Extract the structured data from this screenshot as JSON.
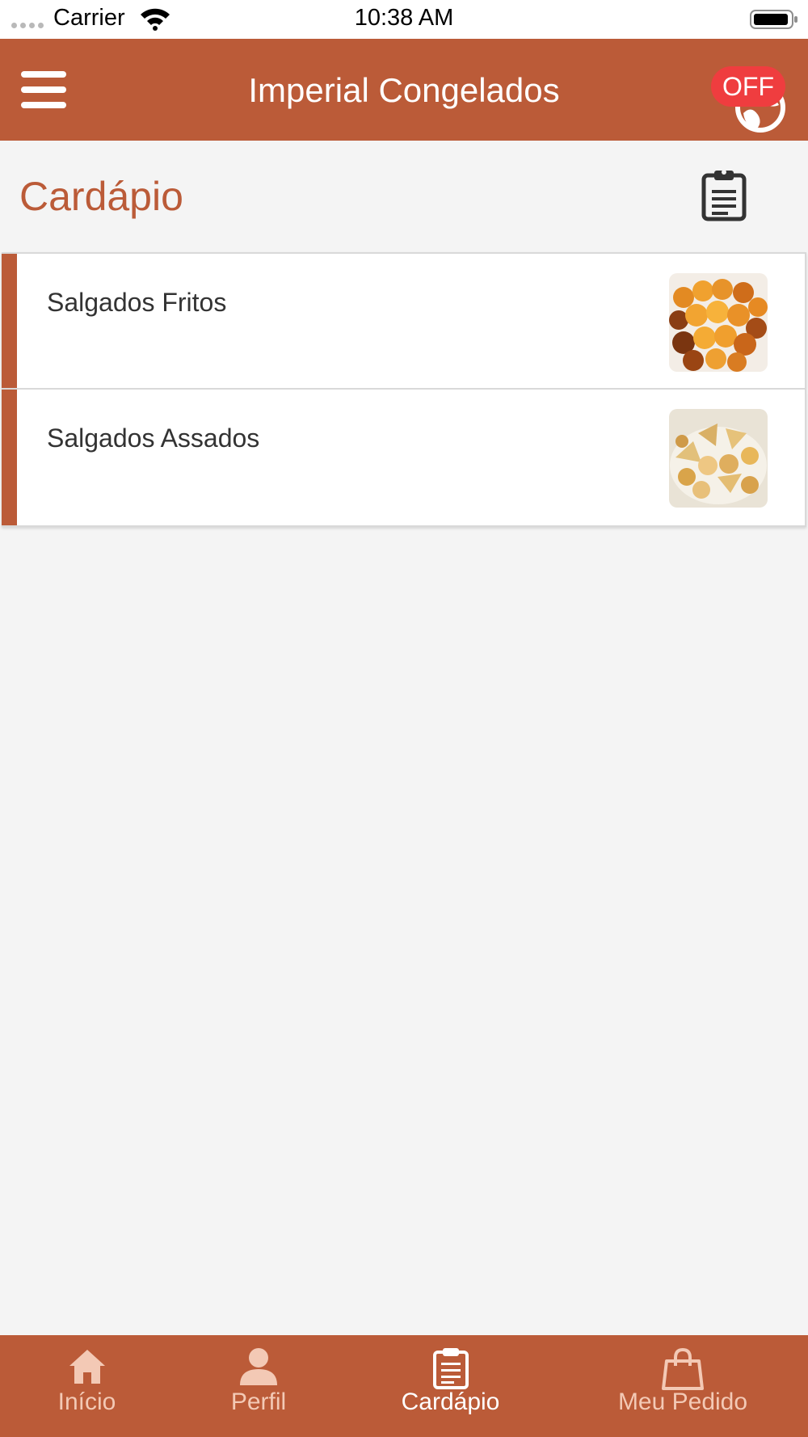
{
  "status_bar": {
    "carrier": "Carrier",
    "time": "10:38 AM"
  },
  "header": {
    "title": "Imperial Congelados",
    "status_badge": "OFF",
    "menu_icon": "hamburger-menu-icon",
    "status_icon": "globe-icon"
  },
  "page": {
    "title": "Cardápio",
    "action_icon": "clipboard-icon"
  },
  "categories": [
    {
      "label": "Salgados Fritos",
      "thumbnail": "fried-snacks-photo"
    },
    {
      "label": "Salgados Assados",
      "thumbnail": "baked-snacks-photo"
    }
  ],
  "tabs": [
    {
      "label": "Início",
      "icon": "home-icon",
      "active": false
    },
    {
      "label": "Perfil",
      "icon": "person-icon",
      "active": false
    },
    {
      "label": "Cardápio",
      "icon": "clipboard-icon",
      "active": true
    },
    {
      "label": "Meu Pedido",
      "icon": "shopping-bag-icon",
      "active": false
    }
  ],
  "colors": {
    "brand": "#bb5b38",
    "badge_red": "#ef3d3f",
    "background": "#f4f4f4",
    "inactive_tab_text": "#f3c9b5"
  }
}
